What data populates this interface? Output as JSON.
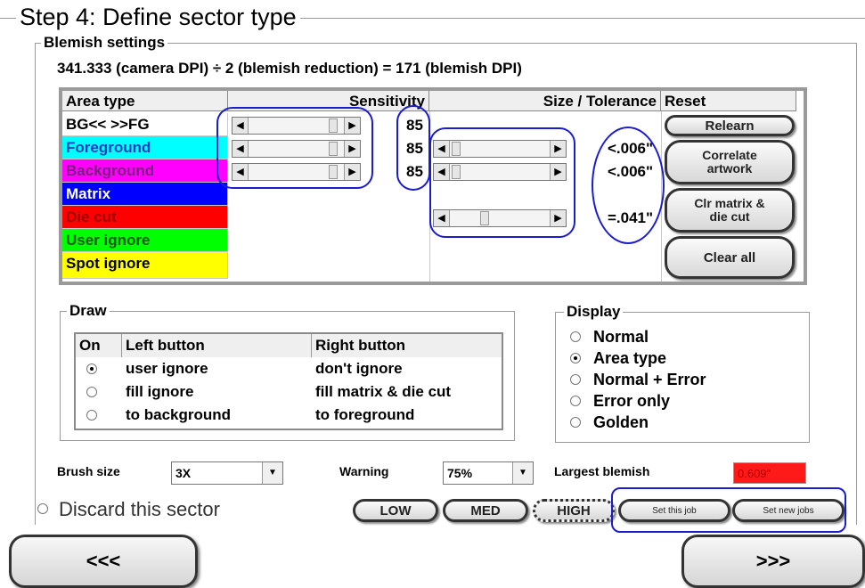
{
  "title": "Step 4: Define sector type",
  "blemish": {
    "legend": "Blemish settings",
    "formula": "341.333 (camera DPI) ÷ 2 (blemish reduction) = 171 (blemish DPI)",
    "headers": {
      "area_type": "Area type",
      "sensitivity": "Sensitivity",
      "size_tolerance": "Size / Tolerance",
      "reset": "Reset"
    },
    "rows": [
      {
        "label": "BG<< >>FG",
        "color": "#ffffff",
        "text_color": "#000000",
        "sensitivity": "85",
        "tolerance": ""
      },
      {
        "label": "Foreground",
        "color": "#00ffff",
        "text_color": "#1a3dc9",
        "sensitivity": "85",
        "tolerance": "<.006\""
      },
      {
        "label": "Background",
        "color": "#ff00ff",
        "text_color": "#7a1f7a",
        "sensitivity": "85",
        "tolerance": "<.006\""
      },
      {
        "label": "Matrix",
        "color": "#0000ff",
        "text_color": "#ffffff",
        "sensitivity": "",
        "tolerance": ""
      },
      {
        "label": "Die cut",
        "color": "#ff0000",
        "text_color": "#a00000",
        "sensitivity": "",
        "tolerance": "=.041\""
      },
      {
        "label": "User ignore",
        "color": "#00ff00",
        "text_color": "#0b5a0b",
        "sensitivity": "",
        "tolerance": ""
      },
      {
        "label": "Spot ignore",
        "color": "#ffff00",
        "text_color": "#000000",
        "sensitivity": "",
        "tolerance": ""
      }
    ],
    "reset_buttons": {
      "relearn": "Relearn",
      "correlate": "Correlate artwork",
      "clr_matrix": "Clr matrix & die cut",
      "clear_all": "Clear all"
    }
  },
  "draw": {
    "legend": "Draw",
    "headers": {
      "on": "On",
      "left": "Left button",
      "right": "Right button"
    },
    "rows": [
      {
        "selected": true,
        "left": "user ignore",
        "right": "don't ignore"
      },
      {
        "selected": false,
        "left": "fill ignore",
        "right": "fill matrix & die cut"
      },
      {
        "selected": false,
        "left": "to background",
        "right": "to foreground"
      }
    ]
  },
  "display": {
    "legend": "Display",
    "options": [
      "Normal",
      "Area type",
      "Normal + Error",
      "Error only",
      "Golden"
    ],
    "selected_index": 1
  },
  "bottom": {
    "brush_label": "Brush size",
    "brush_value": "3X",
    "warning_label": "Warning",
    "warning_value": "75%",
    "largest_label": "Largest blemish",
    "largest_value": "0.609\"",
    "discard_label": "Discard this sector",
    "low": "LOW",
    "med": "MED",
    "high": "HIGH",
    "set_this": "Set this job",
    "set_new": "Set new jobs"
  },
  "nav": {
    "back": "<<<",
    "forward": ">>>"
  },
  "colors": {
    "annotation": "#1c1ccf",
    "largest_bg": "#ff1a1a"
  }
}
